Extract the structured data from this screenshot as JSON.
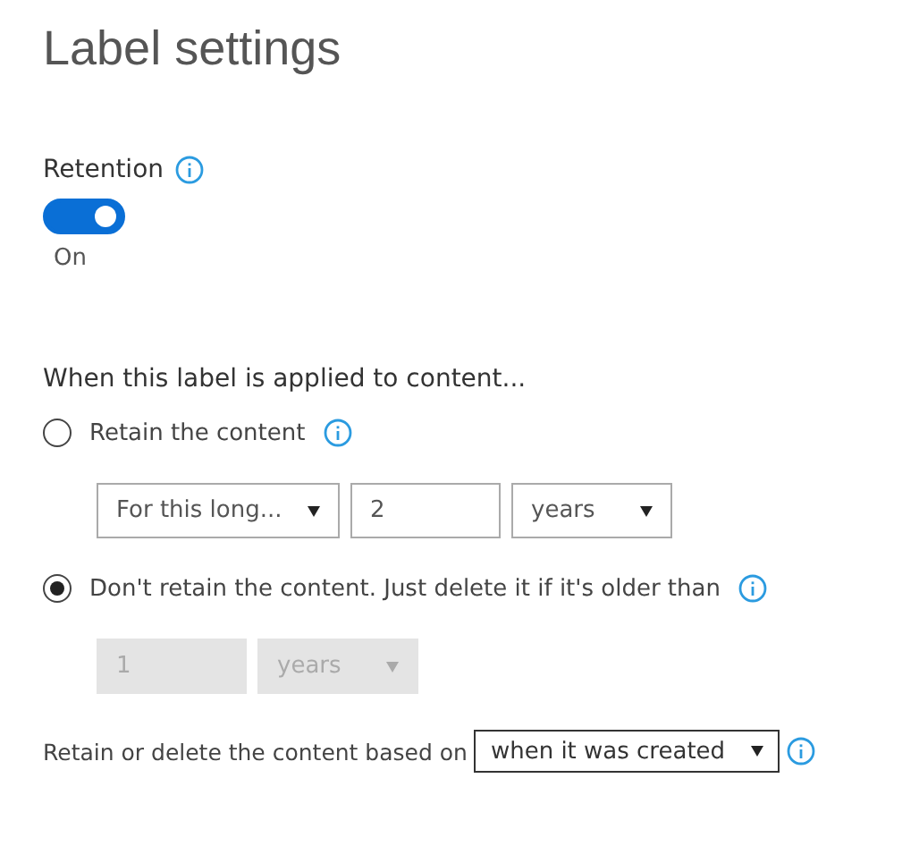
{
  "title": "Label settings",
  "retention": {
    "label": "Retention",
    "on": true,
    "state_text": "On"
  },
  "applied_heading": "When this label is applied to content...",
  "options": [
    {
      "label": "Retain the content",
      "selected": false,
      "controls": [
        {
          "kind": "select",
          "value": "For this long...",
          "disabled": false
        },
        {
          "kind": "input",
          "value": "2",
          "disabled": false
        },
        {
          "kind": "select",
          "value": "years",
          "disabled": false
        }
      ]
    },
    {
      "label": "Don't retain the content. Just delete it if it's older than",
      "selected": true,
      "controls": [
        {
          "kind": "input",
          "value": "1",
          "disabled": true
        },
        {
          "kind": "select",
          "value": "years",
          "disabled": true
        }
      ]
    }
  ],
  "based_on": {
    "label": "Retain or delete the content based on",
    "value": "when it was created"
  }
}
